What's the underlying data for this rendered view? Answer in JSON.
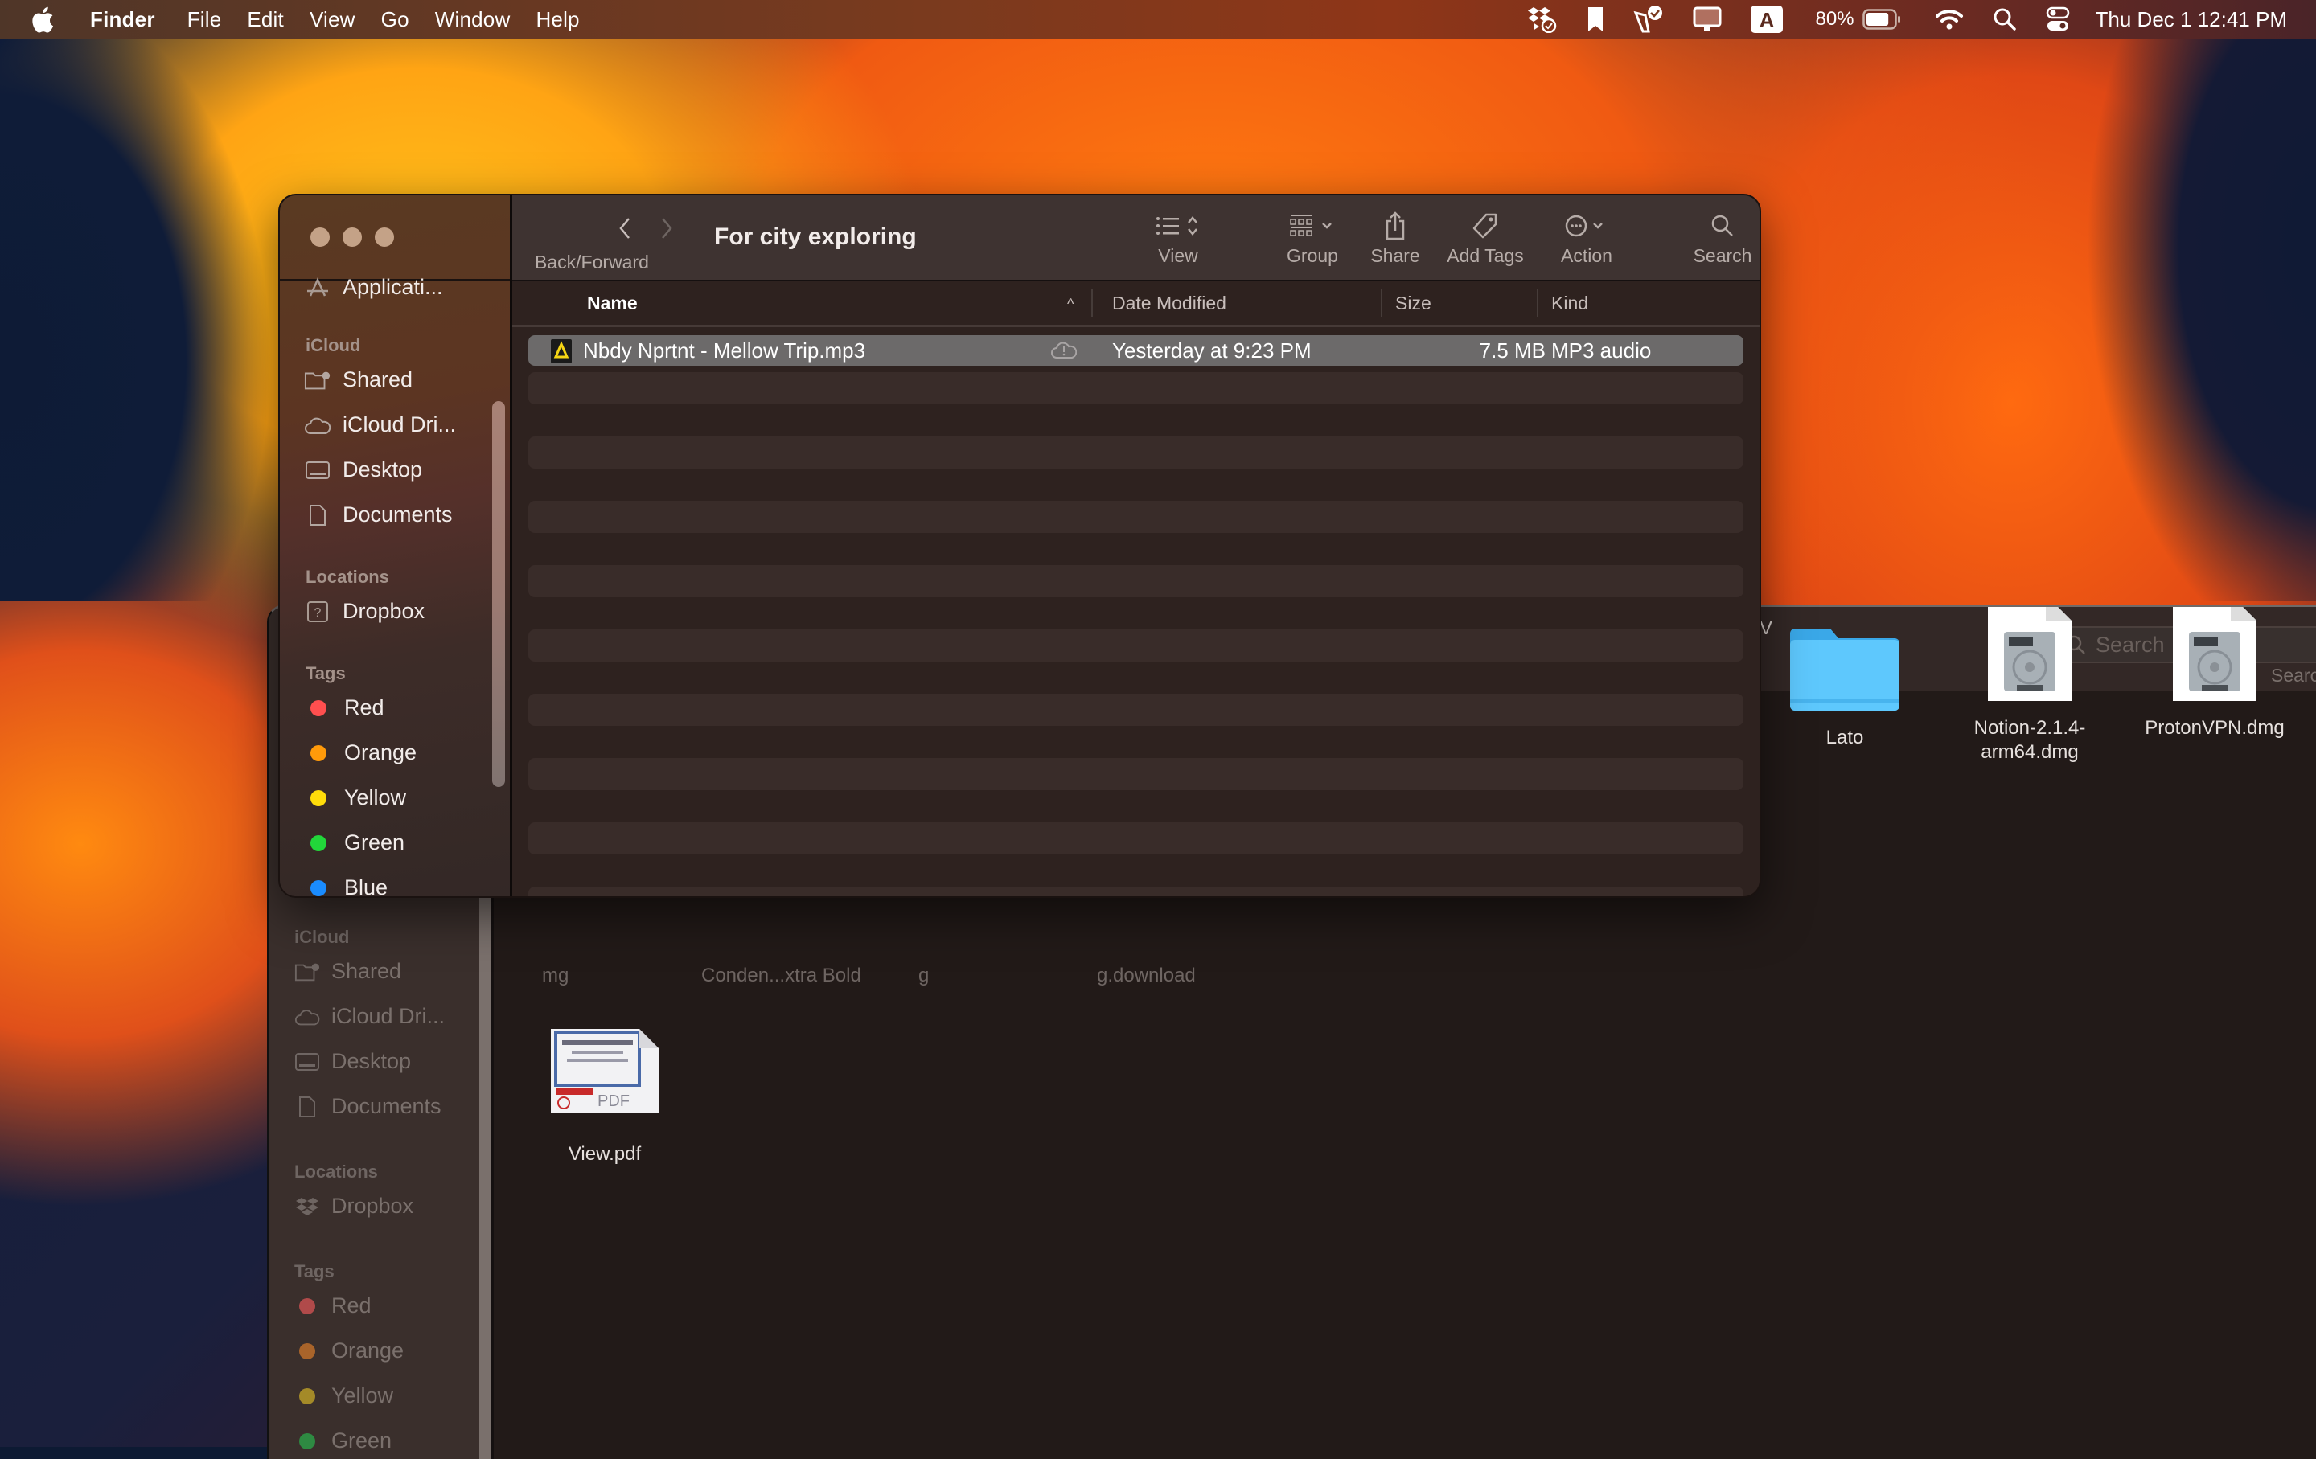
{
  "menubar": {
    "app_name": "Finder",
    "items": [
      "File",
      "Edit",
      "View",
      "Go",
      "Window",
      "Help"
    ],
    "status_icons": [
      "dropbox-icon",
      "bookmark-icon",
      "vpn-check-icon",
      "display-icon",
      "input-source-icon",
      "battery-icon",
      "wifi-icon",
      "spotlight-icon",
      "control-center-icon"
    ],
    "input_source": "A",
    "battery_percent": "80%",
    "battery_level": 0.8,
    "clock": "Thu Dec 1  12:41 PM"
  },
  "front_window": {
    "title": "For city exploring",
    "toolbar": {
      "back_forward_label": "Back/Forward",
      "view_label": "View",
      "group_label": "Group",
      "share_label": "Share",
      "add_tags_label": "Add Tags",
      "action_label": "Action",
      "search_label": "Search"
    },
    "sidebar": {
      "top_item": "Applicati...",
      "sections": [
        {
          "title": "iCloud",
          "items": [
            {
              "label": "Shared",
              "icon": "shared-folder-icon"
            },
            {
              "label": "iCloud Dri...",
              "icon": "cloud-icon"
            },
            {
              "label": "Desktop",
              "icon": "desktop-icon"
            },
            {
              "label": "Documents",
              "icon": "document-icon"
            }
          ]
        },
        {
          "title": "Locations",
          "items": [
            {
              "label": "Dropbox",
              "icon": "unknown-drive-icon"
            }
          ]
        },
        {
          "title": "Tags",
          "items": [
            {
              "label": "Red",
              "color": "#ff4f4f"
            },
            {
              "label": "Orange",
              "color": "#ff9a0a"
            },
            {
              "label": "Yellow",
              "color": "#ffdc0a"
            },
            {
              "label": "Green",
              "color": "#22d63a"
            },
            {
              "label": "Blue",
              "color": "#1a8cff"
            }
          ]
        }
      ]
    },
    "columns": {
      "name": "Name",
      "date_modified": "Date Modified",
      "size": "Size",
      "kind": "Kind",
      "sort_indicator": "^"
    },
    "files": [
      {
        "name": "Nbdy Nprtnt - Mellow Trip.mp3",
        "date_modified": "Yesterday at 9:23 PM",
        "size": "7.5 MB",
        "kind": "MP3 audio",
        "icloud_status": "cloud-warning",
        "selected": true
      }
    ]
  },
  "background_window": {
    "search_placeholder": "Search",
    "search_label": "Search",
    "sidebar": {
      "sections": [
        {
          "title": "iCloud",
          "items": [
            "Shared",
            "iCloud Dri...",
            "Desktop",
            "Documents"
          ]
        },
        {
          "title": "Locations",
          "items": [
            "Dropbox"
          ]
        },
        {
          "title": "Tags",
          "items": [
            {
              "label": "Red",
              "color": "#b04a4a"
            },
            {
              "label": "Orange",
              "color": "#a9642a"
            },
            {
              "label": "Yellow",
              "color": "#a48a28"
            },
            {
              "label": "Green",
              "color": "#2e8a42"
            }
          ]
        }
      ]
    },
    "items": [
      {
        "name": "Lato",
        "type": "folder"
      },
      {
        "name": "Notion-2.1.4-arm64.dmg",
        "name_line1": "Notion-2.1.4-",
        "name_line2": "arm64.dmg",
        "type": "dmg"
      },
      {
        "name": "ProtonVPN.dmg",
        "type": "dmg"
      },
      {
        "name": "View.pdf",
        "type": "pdf"
      }
    ],
    "partial_labels": [
      "mg",
      "Conden...xtra Bold",
      "g",
      "g.download",
      "V"
    ]
  }
}
